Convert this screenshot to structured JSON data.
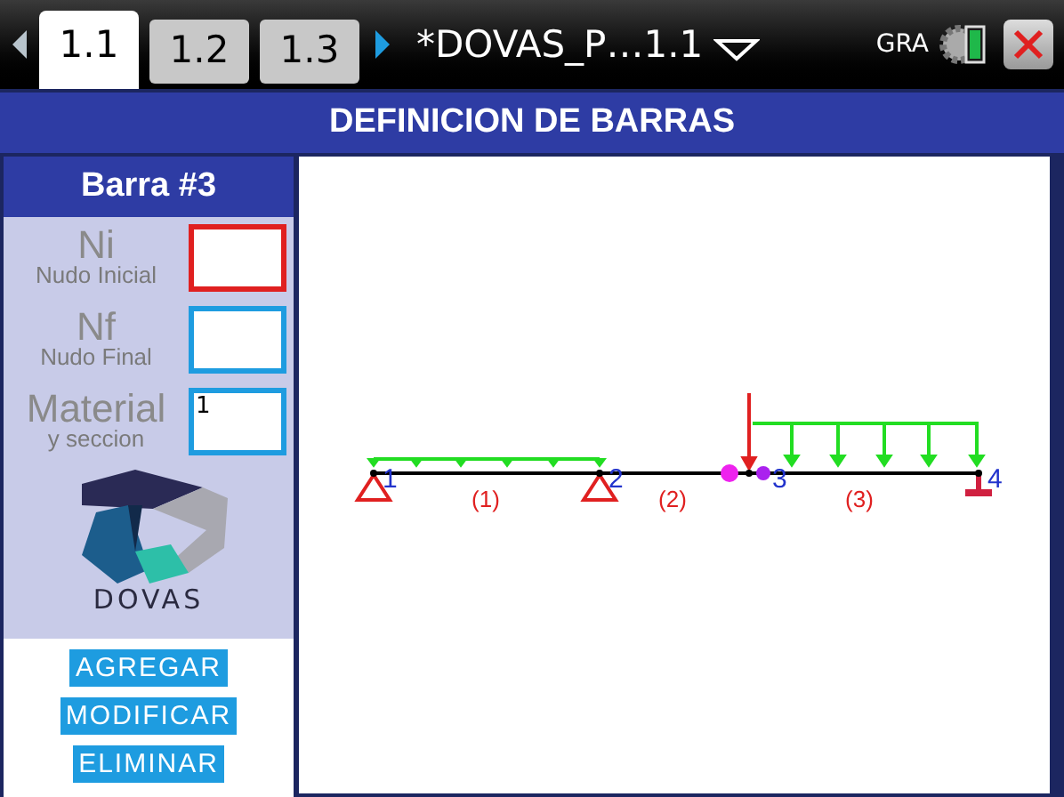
{
  "tabs": [
    {
      "label": "1.1",
      "selected": true
    },
    {
      "label": "1.2",
      "selected": false
    },
    {
      "label": "1.3",
      "selected": false
    }
  ],
  "document_title": "*DOVAS_P…1.1",
  "mode": "GRA",
  "header": "DEFINICION DE BARRAS",
  "panel": {
    "title": "Barra #3",
    "fields": [
      {
        "label": "Ni",
        "sublabel": "Nudo Inicial",
        "focused": true
      },
      {
        "label": "Nf",
        "sublabel": "Nudo Final",
        "focused": false
      },
      {
        "label": "Material",
        "sublabel": "y seccion",
        "value": "1",
        "focused": false
      }
    ],
    "logo_text": "DOVAS",
    "buttons": [
      "AGREGAR",
      "MODIFICAR",
      "ELIMINAR"
    ]
  },
  "diagram": {
    "nodes": [
      {
        "label": "1",
        "kind": "pinned"
      },
      {
        "label": "2",
        "kind": "pinned"
      },
      {
        "label": "3",
        "kind": "hinge"
      },
      {
        "label": "4",
        "kind": "fixed"
      }
    ],
    "bars": [
      {
        "label": "(1)"
      },
      {
        "label": "(2)"
      },
      {
        "label": "(3)"
      }
    ]
  }
}
